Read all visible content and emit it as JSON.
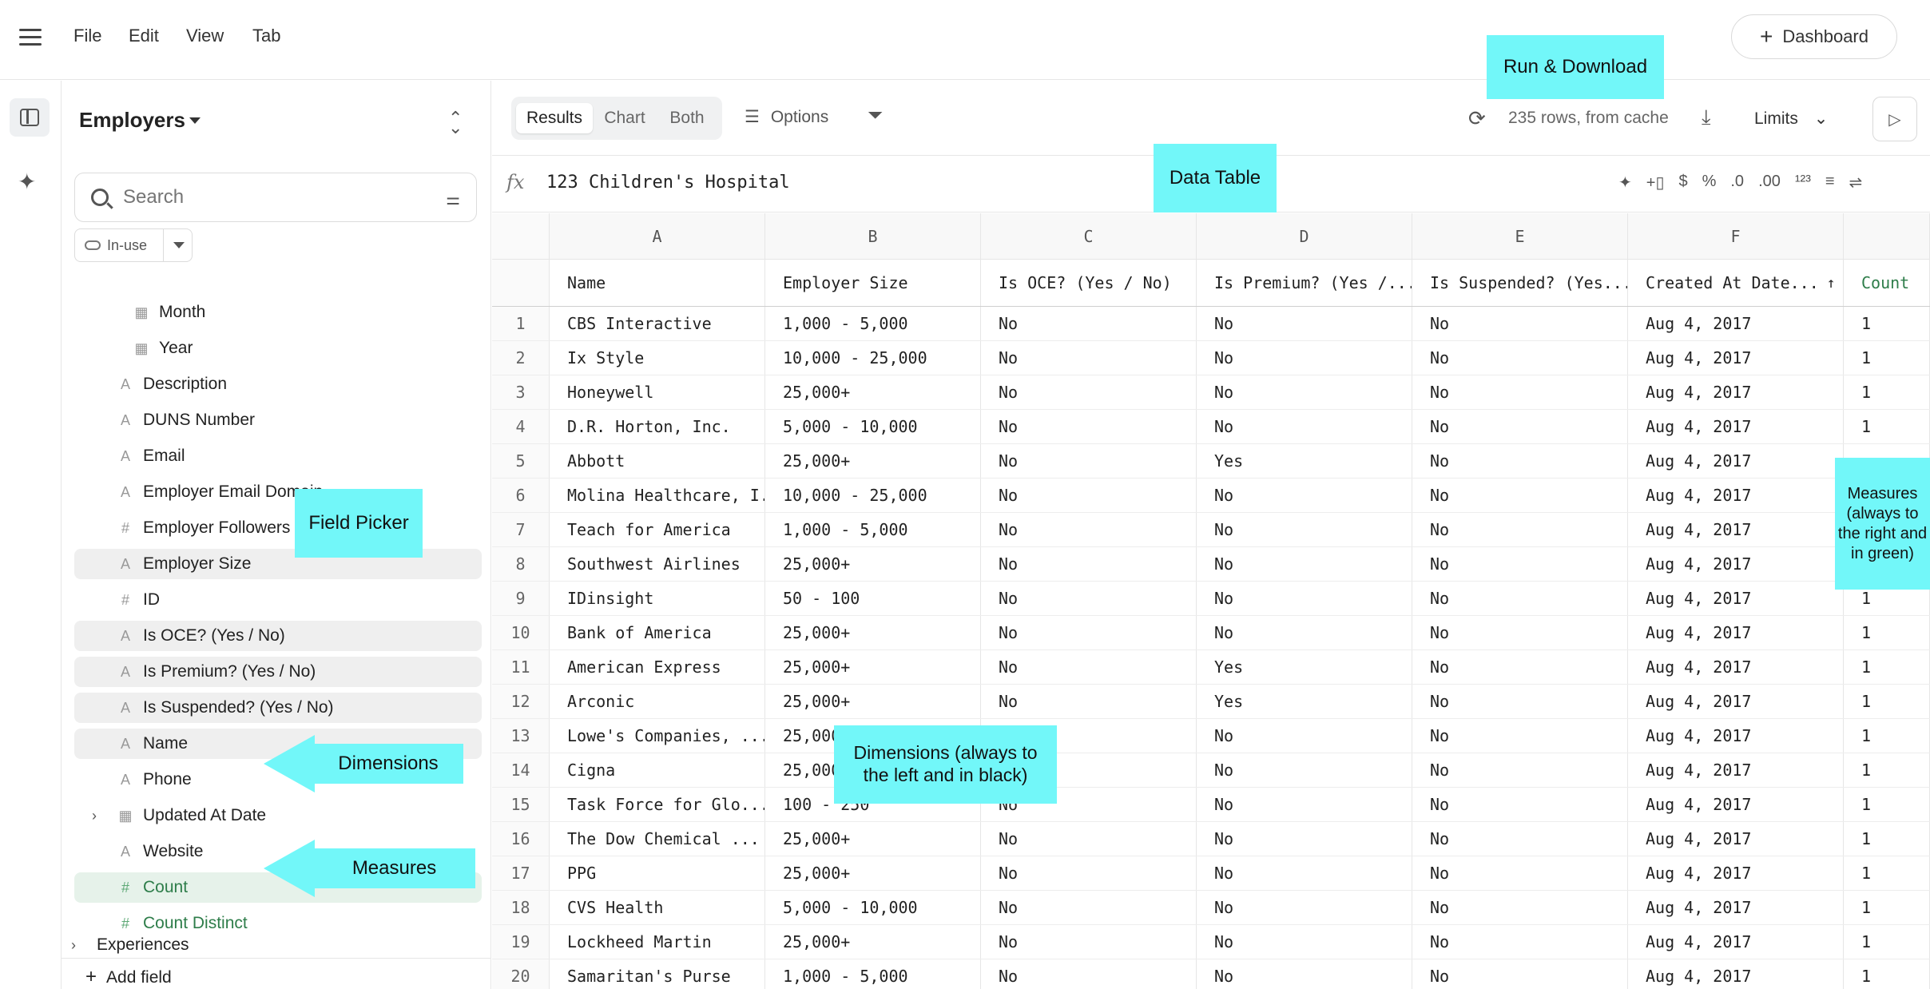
{
  "menu": {
    "file": "File",
    "edit": "Edit",
    "view": "View",
    "tab": "Tab"
  },
  "dashboard_button": "Dashboard",
  "picker": {
    "title": "Employers",
    "search_placeholder": "Search",
    "filter_label": "In-use",
    "fields": [
      {
        "icon": "calendar-icon",
        "label": "Month",
        "kind": "dim",
        "indent": 2,
        "hl": false
      },
      {
        "icon": "calendar-icon",
        "label": "Year",
        "kind": "dim",
        "indent": 2,
        "hl": false
      },
      {
        "icon": "text-icon",
        "label": "Description",
        "kind": "dim",
        "indent": 1,
        "hl": false
      },
      {
        "icon": "text-icon",
        "label": "DUNS Number",
        "kind": "dim",
        "indent": 1,
        "hl": false
      },
      {
        "icon": "text-icon",
        "label": "Email",
        "kind": "dim",
        "indent": 1,
        "hl": false
      },
      {
        "icon": "text-icon",
        "label": "Employer Email Domain",
        "kind": "dim",
        "indent": 1,
        "hl": false
      },
      {
        "icon": "number-icon",
        "label": "Employer Followers (",
        "kind": "dim",
        "indent": 1,
        "hl": false
      },
      {
        "icon": "text-icon",
        "label": "Employer Size",
        "kind": "dim",
        "indent": 1,
        "hl": true
      },
      {
        "icon": "number-icon",
        "label": "ID",
        "kind": "dim",
        "indent": 1,
        "hl": false
      },
      {
        "icon": "text-icon",
        "label": "Is OCE? (Yes / No)",
        "kind": "dim",
        "indent": 1,
        "hl": true
      },
      {
        "icon": "text-icon",
        "label": "Is Premium? (Yes / No)",
        "kind": "dim",
        "indent": 1,
        "hl": true
      },
      {
        "icon": "text-icon",
        "label": "Is Suspended? (Yes / No)",
        "kind": "dim",
        "indent": 1,
        "hl": true
      },
      {
        "icon": "text-icon",
        "label": "Name",
        "kind": "dim",
        "indent": 1,
        "hl": true
      },
      {
        "icon": "text-icon",
        "label": "Phone",
        "kind": "dim",
        "indent": 1,
        "hl": false
      },
      {
        "icon": "calendar-icon",
        "label": "Updated At Date",
        "kind": "dim",
        "indent": 1,
        "hl": false,
        "expandable": true
      },
      {
        "icon": "text-icon",
        "label": "Website",
        "kind": "dim",
        "indent": 1,
        "hl": false
      },
      {
        "icon": "number-icon",
        "label": "Count",
        "kind": "measure",
        "indent": 1,
        "hl": true
      },
      {
        "icon": "number-icon",
        "label": "Count Distinct",
        "kind": "measure",
        "indent": 1,
        "hl": false
      }
    ],
    "group_label": "Experiences",
    "add_field": "Add field"
  },
  "toolbar": {
    "tabs": [
      "Results",
      "Chart",
      "Both"
    ],
    "active_tab": "Results",
    "options": "Options",
    "rows_status": "235 rows, from cache",
    "limits": "Limits"
  },
  "formula": {
    "fx": "fx",
    "value": "123 Children's Hospital"
  },
  "table": {
    "col_letters": [
      "A",
      "B",
      "C",
      "D",
      "E",
      "F",
      ""
    ],
    "headers": [
      "Name",
      "Employer Size",
      "Is OCE? (Yes / No)",
      "Is Premium? (Yes /...",
      "Is Suspended? (Yes...",
      "Created At Date...",
      "Count"
    ],
    "rows": [
      [
        "1",
        "CBS Interactive",
        "1,000 - 5,000",
        "No",
        "No",
        "No",
        "Aug 4, 2017",
        "1"
      ],
      [
        "2",
        "Ix Style",
        "10,000 - 25,000",
        "No",
        "No",
        "No",
        "Aug 4, 2017",
        "1"
      ],
      [
        "3",
        "Honeywell",
        "25,000+",
        "No",
        "No",
        "No",
        "Aug 4, 2017",
        "1"
      ],
      [
        "4",
        "D.R. Horton, Inc.",
        "5,000 - 10,000",
        "No",
        "No",
        "No",
        "Aug 4, 2017",
        "1"
      ],
      [
        "5",
        "Abbott",
        "25,000+",
        "No",
        "Yes",
        "No",
        "Aug 4, 2017",
        ""
      ],
      [
        "6",
        "Molina Healthcare, I...",
        "10,000 - 25,000",
        "No",
        "No",
        "No",
        "Aug 4, 2017",
        ""
      ],
      [
        "7",
        "Teach for America",
        "1,000 - 5,000",
        "No",
        "No",
        "No",
        "Aug 4, 2017",
        ""
      ],
      [
        "8",
        "Southwest Airlines",
        "25,000+",
        "No",
        "No",
        "No",
        "Aug 4, 2017",
        ""
      ],
      [
        "9",
        "IDinsight",
        "50 - 100",
        "No",
        "No",
        "No",
        "Aug 4, 2017",
        "1"
      ],
      [
        "10",
        "Bank of America",
        "25,000+",
        "No",
        "No",
        "No",
        "Aug 4, 2017",
        "1"
      ],
      [
        "11",
        "American Express",
        "25,000+",
        "No",
        "Yes",
        "No",
        "Aug 4, 2017",
        "1"
      ],
      [
        "12",
        "Arconic",
        "25,000+",
        "No",
        "Yes",
        "No",
        "Aug 4, 2017",
        "1"
      ],
      [
        "13",
        "Lowe's Companies, ...",
        "25,000+",
        "",
        "No",
        "No",
        "Aug 4, 2017",
        "1"
      ],
      [
        "14",
        "Cigna",
        "25,000+",
        "",
        "No",
        "No",
        "Aug 4, 2017",
        "1"
      ],
      [
        "15",
        "Task Force for Glo...",
        "100 - 250",
        "No",
        "No",
        "No",
        "Aug 4, 2017",
        "1"
      ],
      [
        "16",
        "The Dow Chemical ...",
        "25,000+",
        "No",
        "No",
        "No",
        "Aug 4, 2017",
        "1"
      ],
      [
        "17",
        "PPG",
        "25,000+",
        "No",
        "No",
        "No",
        "Aug 4, 2017",
        "1"
      ],
      [
        "18",
        "CVS Health",
        "5,000 - 10,000",
        "No",
        "No",
        "No",
        "Aug 4, 2017",
        "1"
      ],
      [
        "19",
        "Lockheed Martin",
        "25,000+",
        "No",
        "No",
        "No",
        "Aug 4, 2017",
        "1"
      ],
      [
        "20",
        "Samaritan's Purse",
        "1,000 - 5,000",
        "No",
        "No",
        "No",
        "Aug 4, 2017",
        "1"
      ]
    ]
  },
  "annotations": {
    "run_download": "Run & Download",
    "data_table": "Data Table",
    "field_picker": "Field Picker",
    "dimensions": "Dimensions",
    "measures": "Measures",
    "dimensions_note": "Dimensions (always to the left and in black)",
    "measures_note": "Measures (always to the right and in green)"
  },
  "colors": {
    "annotation": "#72f7f9",
    "measure_green": "#2e7d4a"
  }
}
